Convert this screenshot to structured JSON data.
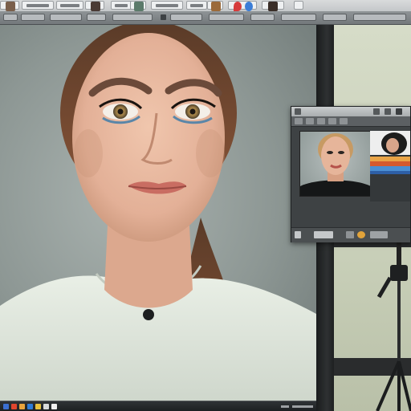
{
  "app": {
    "title": ""
  },
  "top_toolbar": {
    "tabs": [
      {
        "thumb": "portrait-thumb"
      },
      {
        "thumb": "text-tab"
      },
      {
        "thumb": "text-tab"
      },
      {
        "thumb": "text-tab"
      },
      {
        "thumb": "portrait-thumb"
      },
      {
        "thumb": "text-tab"
      },
      {
        "thumb": "portrait-thumb"
      },
      {
        "thumb": "text-tab"
      },
      {
        "thumb": "location-pin"
      },
      {
        "thumb": "portrait-thumb"
      },
      {
        "thumb": "blank-tab"
      }
    ]
  },
  "canvas": {
    "subject": "portrait-photo"
  },
  "preview_window": {
    "title": "",
    "subject": "portrait-preview"
  },
  "taskbar": {
    "items": [
      "start-icon",
      "folder-icon",
      "browser-icon",
      "app-icon",
      "app-icon",
      "app-icon",
      "app-icon"
    ]
  },
  "colors": {
    "toolbar": "#c8cbcd",
    "canvas_bg": "#8d9794",
    "backdrop": "#d1d7c2",
    "taskbar": "#1f2224"
  }
}
